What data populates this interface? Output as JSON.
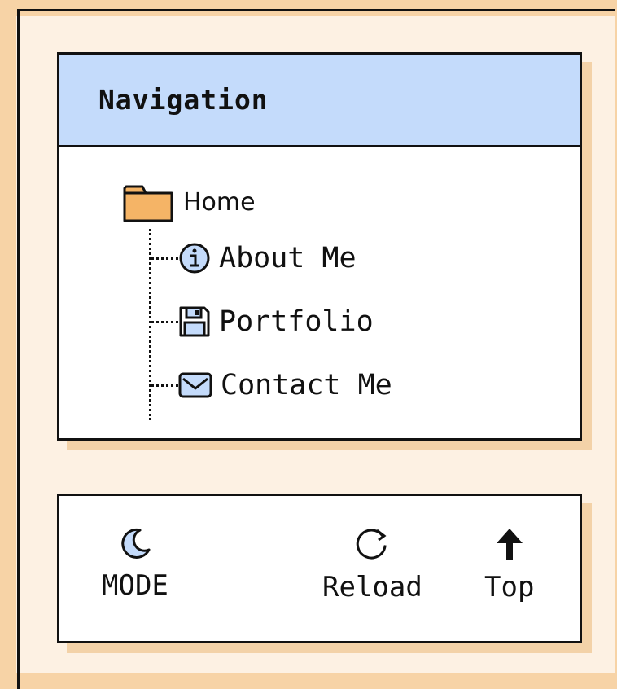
{
  "navigation": {
    "title": "Navigation",
    "home": {
      "label": "Home",
      "icon": "folder-icon"
    },
    "items": [
      {
        "label": "About Me",
        "icon": "info-icon"
      },
      {
        "label": "Portfolio",
        "icon": "floppy-disk-icon"
      },
      {
        "label": "Contact Me",
        "icon": "envelope-icon"
      }
    ]
  },
  "toolbar": {
    "mode_label": "MODE",
    "reload_label": "Reload",
    "top_label": "Top"
  },
  "colors": {
    "background": "#fdf1e3",
    "border_accent": "#f7d3a6",
    "header_blue": "#c4dbfb",
    "folder_orange": "#f5b466",
    "shadow": "#f3d2a8"
  }
}
